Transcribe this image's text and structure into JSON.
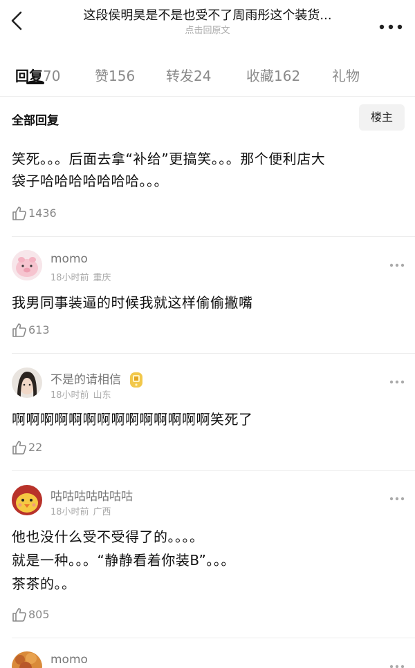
{
  "header": {
    "title": "这段侯明昊是不是也受不了周雨彤这个装货...",
    "subtitle": "点击回原文"
  },
  "tabs": [
    {
      "label": "回复",
      "count": "70"
    },
    {
      "label": "赞",
      "count": "156"
    },
    {
      "label": "转发",
      "count": "24"
    },
    {
      "label": "收藏",
      "count": "162"
    },
    {
      "label": "礼物",
      "count": ""
    }
  ],
  "section": {
    "title": "全部回复",
    "owner_button": "楼主"
  },
  "top_post": {
    "line1": "笑死。。。后面去拿“补给”更搞笑。。。那个便利店大",
    "line2": "袋子哈哈哈哈哈哈哈。。。",
    "likes": "1436"
  },
  "comments": [
    {
      "username": "momo",
      "time": "18小时前",
      "location": "重庆",
      "lines": [
        "我男同事装逼的时候我就这样偷偷撇嘴"
      ],
      "likes": "613"
    },
    {
      "username": "不是的请相信",
      "time": "18小时前",
      "location": "山东",
      "lines": [
        "啊啊啊啊啊啊啊啊啊啊啊啊啊啊笑死了"
      ],
      "likes": "22"
    },
    {
      "username": "咕咕咕咕咕咕咕",
      "time": "18小时前",
      "location": "广西",
      "lines": [
        "他也没什么受不受得了的。。。。",
        "就是一种。。。“静静看着你装B”。。。",
        "茶茶的。。"
      ],
      "likes": "805"
    },
    {
      "username": "momo"
    }
  ],
  "colors": {
    "text_primary": "#111111",
    "text_secondary": "#888888",
    "divider": "#ececec",
    "button_bg": "#f2f2f2"
  }
}
